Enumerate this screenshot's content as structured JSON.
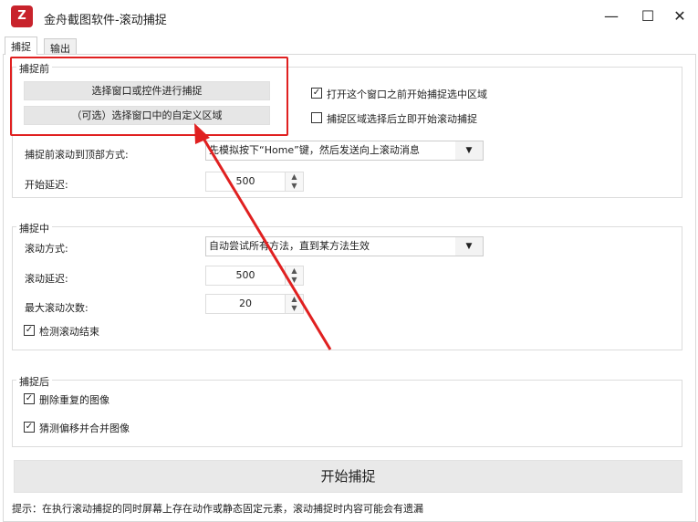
{
  "window": {
    "title": "金舟截图软件-滚动捕捉",
    "logo_text": "Z",
    "minimize": "—",
    "maximize": "☐",
    "close": "✕"
  },
  "tabs": [
    {
      "label": "捕捉"
    },
    {
      "label": "输出"
    }
  ],
  "before": {
    "title": "捕捉前",
    "select_btn": "选择窗口或控件进行捕捉",
    "custom_btn": "（可选）选择窗口中的自定义区域",
    "cb1": "打开这个窗口之前开始捕捉选中区域",
    "cb1_checked": true,
    "cb2": "捕捉区域选择后立即开始滚动捕捉",
    "cb2_checked": false,
    "scroll_top_label": "捕捉前滚动到顶部方式:",
    "scroll_top_value": "先模拟按下“Home”键，然后发送向上滚动消息",
    "delay_label": "开始延迟:",
    "delay_value": "500"
  },
  "during": {
    "title": "捕捉中",
    "mode_label": "滚动方式:",
    "mode_value": "自动尝试所有方法，直到某方法生效",
    "delay_label": "滚动延迟:",
    "delay_value": "500",
    "max_label": "最大滚动次数:",
    "max_value": "20",
    "detect": "检测滚动结束",
    "detect_checked": true
  },
  "after": {
    "title": "捕捉后",
    "dedupe": "删除重复的图像",
    "merge": "猜测偏移并合并图像"
  },
  "start_btn": "开始捕捉",
  "hint": "提示：在执行滚动捕捉的同时屏幕上存在动作或静态固定元素，滚动捕捉时内容可能会有遗漏",
  "annotation_color": "#e02020",
  "check": "✓",
  "arrow_down": "▼",
  "up": "⌃",
  "down": "⌄"
}
